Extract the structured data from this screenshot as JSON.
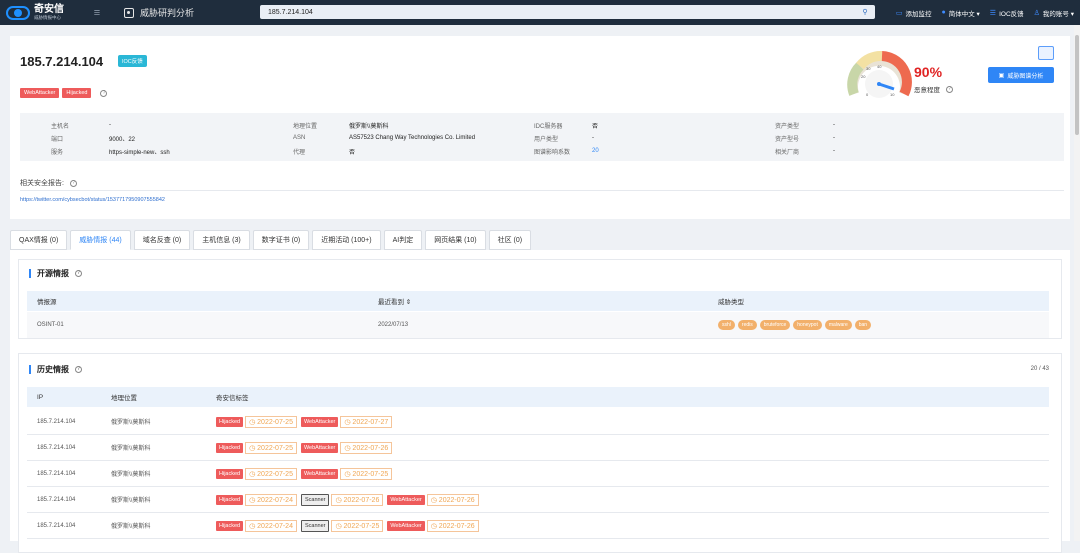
{
  "topbar": {
    "logo_title": "奇安信",
    "logo_sub": "威胁情报中心",
    "page_title": "威胁研判分析",
    "search_value": "185.7.214.104",
    "right_items": [
      "添加监控",
      "简体中文 ▾",
      "IOC反馈",
      "我的账号 ▾"
    ]
  },
  "header": {
    "ip": "185.7.214.104",
    "ioc_badge": "IOC反馈",
    "tags": [
      "WebAttacker",
      "Hijacked"
    ],
    "score": "90%",
    "score_label": "恶意程度",
    "analyze_button": "威胁图谱分析",
    "gauge_ticks": [
      "20",
      "30",
      "40",
      "0",
      "10"
    ],
    "colors": {
      "danger": "#e02424",
      "primary": "#2f86f6"
    }
  },
  "info": {
    "col1": [
      {
        "k": "主机名",
        "v": "-"
      },
      {
        "k": "端口",
        "v": "9000、22"
      },
      {
        "k": "服务",
        "v": "https-simple-new、ssh"
      }
    ],
    "col2": [
      {
        "k": "地理位置",
        "v": "俄罗斯\\\\莫斯科"
      },
      {
        "k": "ASN",
        "v": "AS57523 Chang Way Technologies Co. Limited"
      },
      {
        "k": "代理",
        "v": "否"
      }
    ],
    "col3": [
      {
        "k": "IDC服务器",
        "v": "否"
      },
      {
        "k": "用户类型",
        "v": "-"
      },
      {
        "k": "图谱影响系数",
        "v": "20"
      }
    ],
    "col4": [
      {
        "k": "资产类型",
        "v": "-"
      },
      {
        "k": "资产型号",
        "v": "-"
      },
      {
        "k": "相关厂商",
        "v": "-"
      }
    ]
  },
  "report": {
    "label": "相关安全报告:",
    "link": "https://twitter.com/cybsecbot/status/1537717950907555842"
  },
  "tabs": [
    "QAX情报 (0)",
    "威胁情报 (44)",
    "域名反查 (0)",
    "主机信息 (3)",
    "数字证书 (0)",
    "近期活动 (100+)",
    "AI判定",
    "网页结果 (10)",
    "社区 (0)"
  ],
  "open_intel": {
    "title": "开源情报",
    "headers": [
      "情报源",
      "最近看到 ⇕",
      "威胁类型"
    ],
    "rows": [
      {
        "source": "OSINT-01",
        "date": "2022/07/13",
        "types": [
          "sshl",
          "redis",
          "bruteforce",
          "honeypot",
          "malware",
          "ban"
        ]
      }
    ]
  },
  "history": {
    "title": "历史情报",
    "counter": "20 / 43",
    "headers": [
      "IP",
      "地理位置",
      "奇安信标签"
    ],
    "rows": [
      {
        "ip": "185.7.214.104",
        "geo": "俄罗斯\\\\莫斯科",
        "tags": [
          {
            "t": "Hijacked",
            "d": "2022-07-25",
            "c": "red"
          },
          {
            "t": "WebAttacker",
            "d": "2022-07-27",
            "c": "red"
          }
        ]
      },
      {
        "ip": "185.7.214.104",
        "geo": "俄罗斯\\\\莫斯科",
        "tags": [
          {
            "t": "Hijacked",
            "d": "2022-07-25",
            "c": "red"
          },
          {
            "t": "WebAttacker",
            "d": "2022-07-26",
            "c": "red"
          }
        ]
      },
      {
        "ip": "185.7.214.104",
        "geo": "俄罗斯\\\\莫斯科",
        "tags": [
          {
            "t": "Hijacked",
            "d": "2022-07-25",
            "c": "red"
          },
          {
            "t": "WebAttacker",
            "d": "2022-07-25",
            "c": "red"
          }
        ]
      },
      {
        "ip": "185.7.214.104",
        "geo": "俄罗斯\\\\莫斯科",
        "tags": [
          {
            "t": "Hijacked",
            "d": "2022-07-24",
            "c": "red"
          },
          {
            "t": "Scanner",
            "d": "2022-07-26",
            "c": "gray"
          },
          {
            "t": "WebAttacker",
            "d": "2022-07-26",
            "c": "red"
          }
        ]
      },
      {
        "ip": "185.7.214.104",
        "geo": "俄罗斯\\\\莫斯科",
        "tags": [
          {
            "t": "Hijacked",
            "d": "2022-07-24",
            "c": "red"
          },
          {
            "t": "Scanner",
            "d": "2022-07-25",
            "c": "gray"
          },
          {
            "t": "WebAttacker",
            "d": "2022-07-26",
            "c": "red"
          }
        ]
      }
    ]
  }
}
